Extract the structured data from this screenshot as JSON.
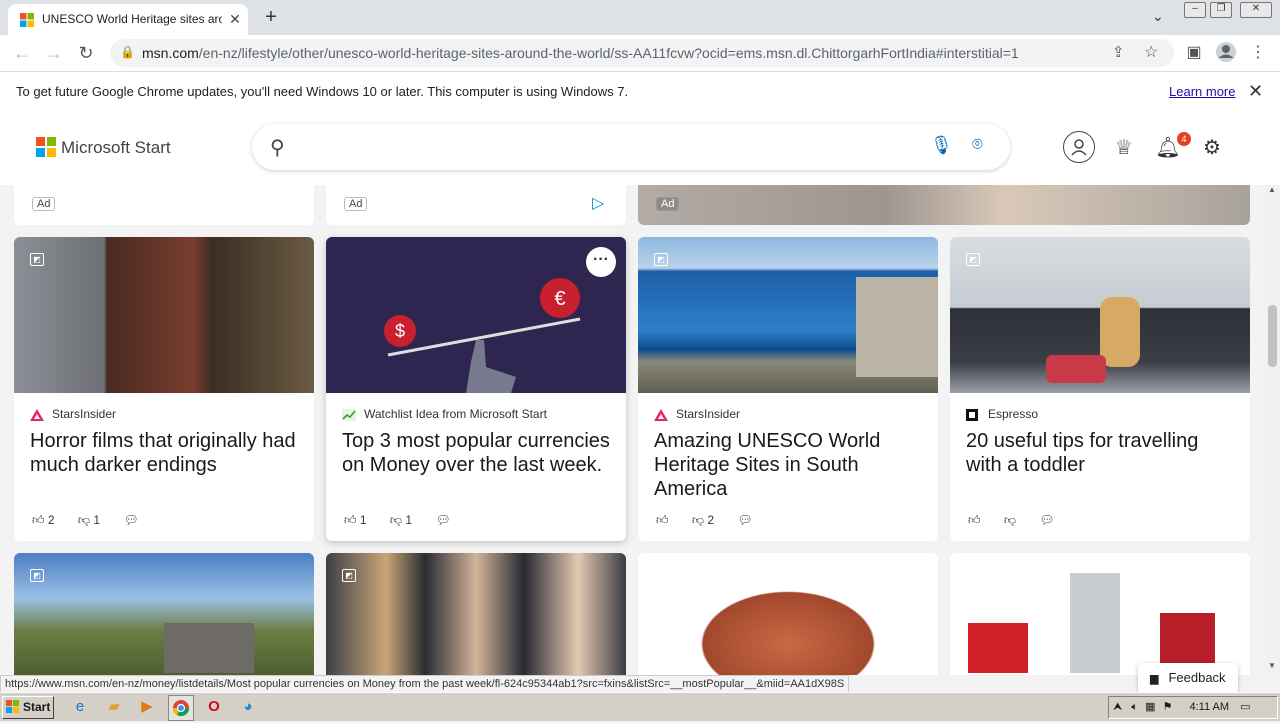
{
  "browser": {
    "tab_title": "UNESCO World Heritage sites around",
    "url_host": "msn.com",
    "url_rest": "/en-nz/lifestyle/other/unesco-world-heritage-sites-around-the-world/ss-AA11fcvw?ocid=ems.msn.dl.ChittorgarhFortIndia#interstitial=1"
  },
  "infobar": {
    "message": "To get future Google Chrome updates, you'll need Windows 10 or later. This computer is using Windows 7.",
    "learn_more": "Learn more"
  },
  "msn": {
    "brand": "Microsoft Start",
    "notification_count": "4"
  },
  "ads": {
    "label": "Ad"
  },
  "cards": [
    {
      "source": "StarsInsider",
      "headline": "Horror films that originally had much darker endings",
      "likes": "2",
      "dislikes": "1"
    },
    {
      "source": "Watchlist Idea from Microsoft Start",
      "headline": "Top 3 most popular currencies on Money over the last week.",
      "likes": "1",
      "dislikes": "1"
    },
    {
      "source": "StarsInsider",
      "headline": "Amazing UNESCO World Heritage Sites in South America",
      "likes": "",
      "dislikes": "2"
    },
    {
      "source": "Espresso",
      "headline": "20 useful tips for travelling with a toddler",
      "likes": "",
      "dislikes": ""
    }
  ],
  "status_url": "https://www.msn.com/en-nz/money/listdetails/Most popular currencies on Money from the past week/fl-624c95344ab1?src=fxins&listSrc=__mostPopular__&miid=AA1dX98S",
  "feedback": "Feedback",
  "taskbar": {
    "start": "Start",
    "time": "4:11 AM"
  },
  "colors": {
    "accent": "#0067b8",
    "badge": "#e3411d",
    "stars_insider": "#e5285a"
  }
}
